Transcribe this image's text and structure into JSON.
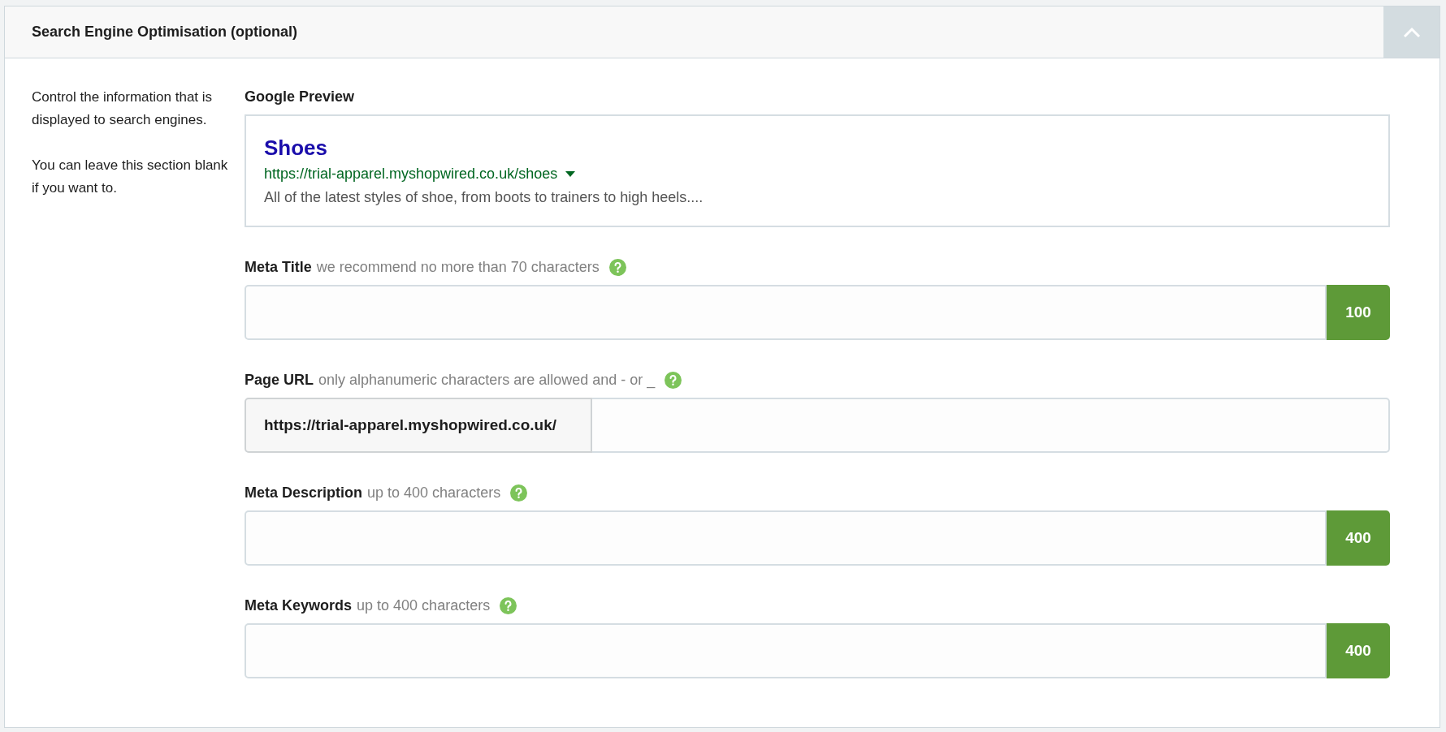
{
  "panel": {
    "title": "Search Engine Optimisation (optional)",
    "expanded": true
  },
  "intro": [
    "Control the information that is displayed to search engines.",
    "You can leave this section blank if you want to."
  ],
  "preview": {
    "label": "Google Preview",
    "title": "Shoes",
    "url": "https://trial-apparel.myshopwired.co.uk/shoes",
    "description": "All of the latest styles of shoe, from boots to trainers to high heels...."
  },
  "fields": [
    {
      "kind": "counter",
      "label": "Meta Title",
      "hint": "we recommend no more than 70 characters",
      "counter": "100"
    },
    {
      "kind": "prefix",
      "label": "Page URL",
      "hint": "only alphanumeric characters are allowed and - or _",
      "prefix": "https://trial-apparel.myshopwired.co.uk/"
    },
    {
      "kind": "counter",
      "label": "Meta Description",
      "hint": "up to 400 characters",
      "counter": "400"
    },
    {
      "kind": "counter",
      "label": "Meta Keywords",
      "hint": "up to 400 characters",
      "counter": "400"
    }
  ]
}
